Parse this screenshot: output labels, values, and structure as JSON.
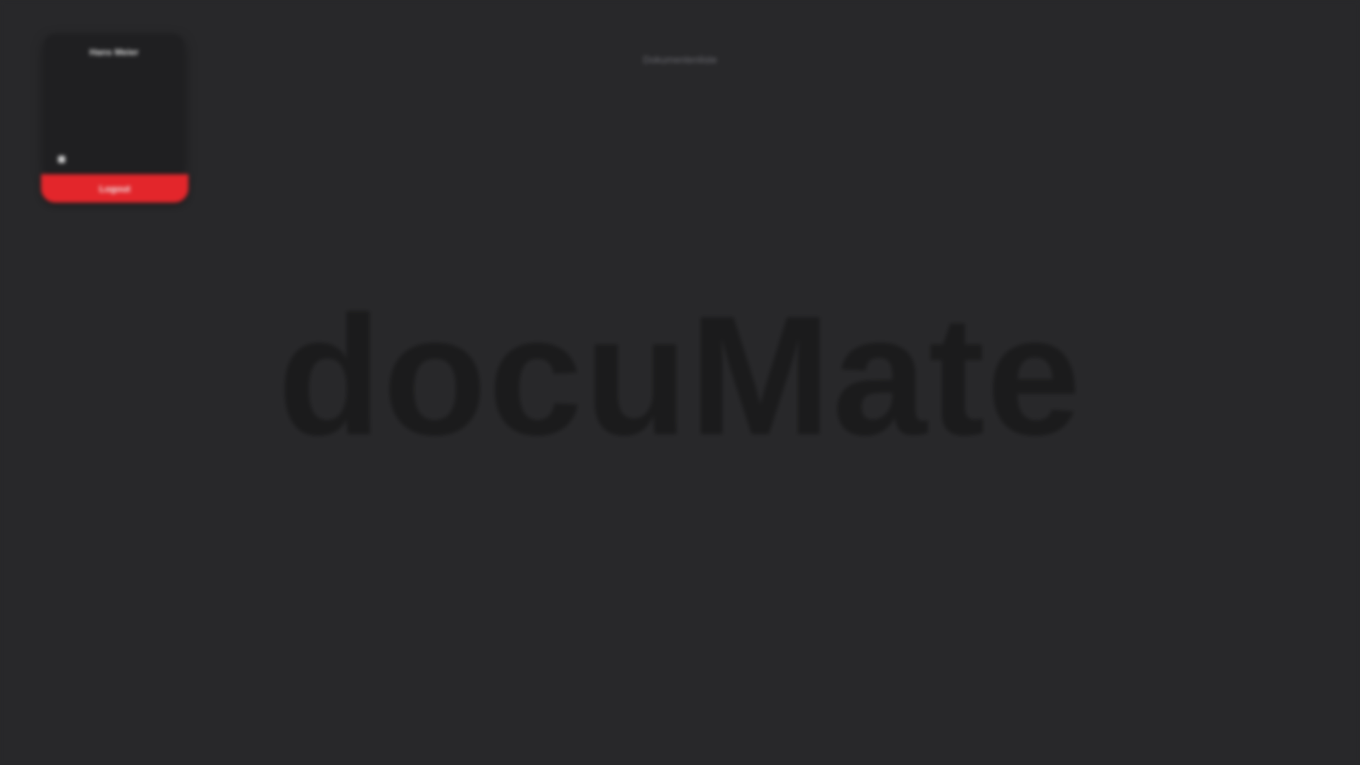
{
  "panel": {
    "title": "Hans Meier",
    "logout_label": "Logout"
  },
  "header": {
    "caption": "Dokumentenliste"
  },
  "brand": {
    "name": "docuMate"
  },
  "colors": {
    "background": "#28282a",
    "panel": "#1f1f21",
    "accent": "#e3262b"
  }
}
